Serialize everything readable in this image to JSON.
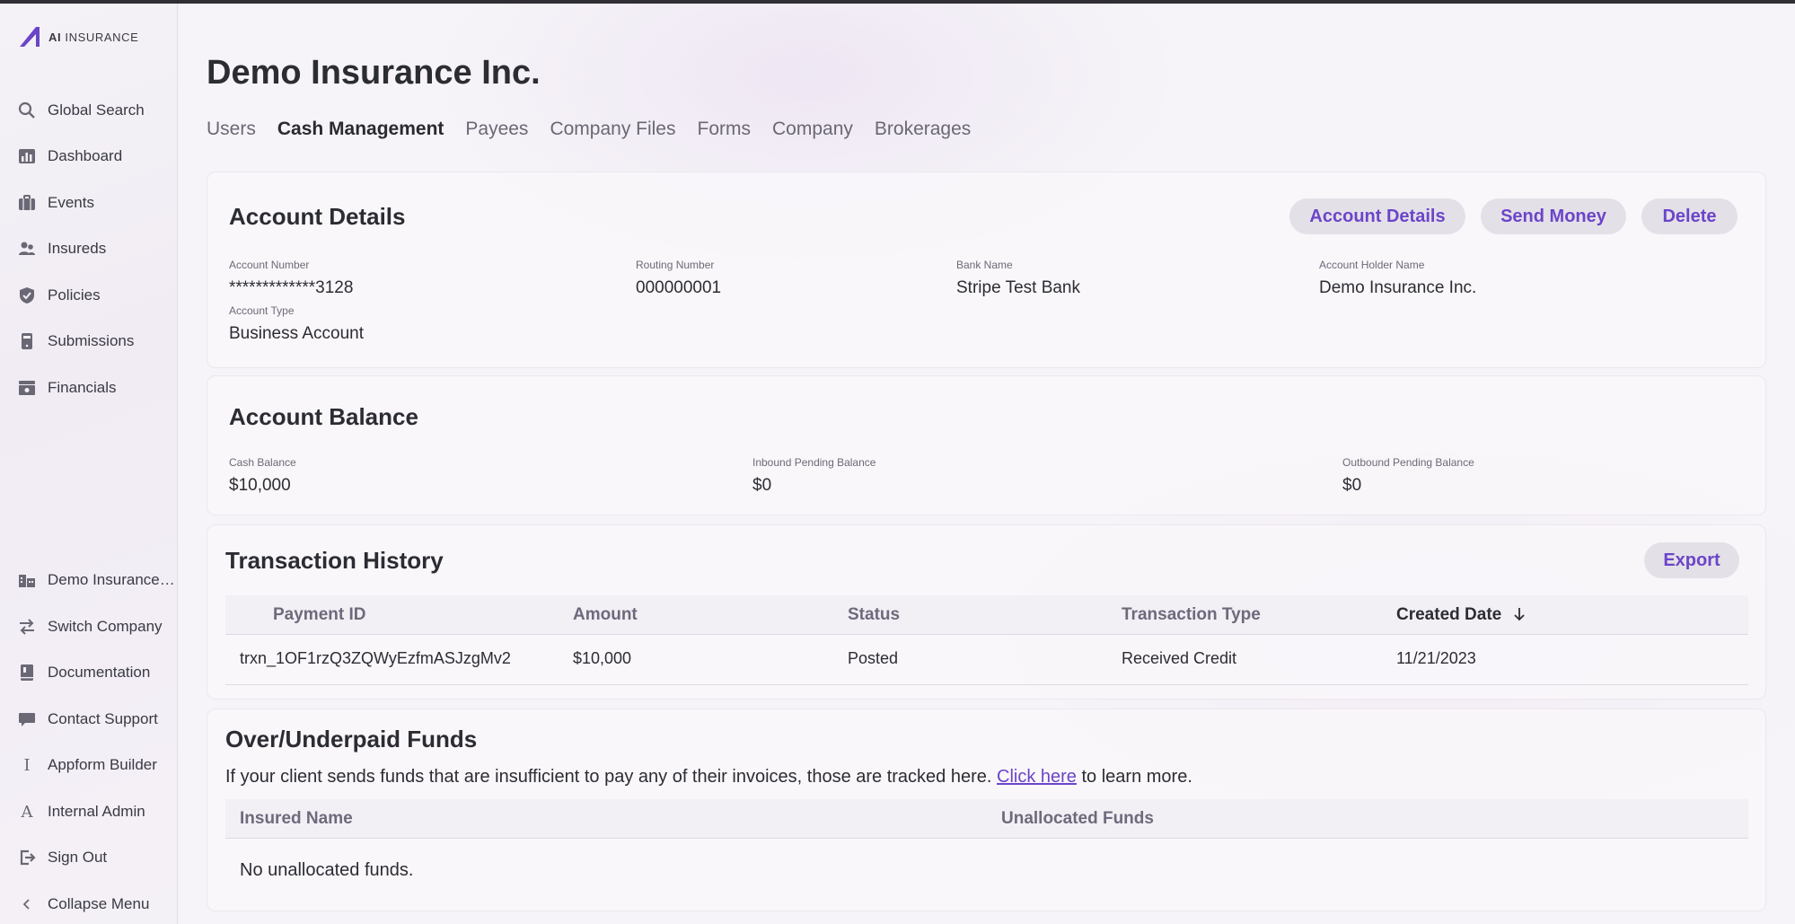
{
  "app": {
    "logo_text_bold": "AI",
    "logo_text": "INSURANCE",
    "accent_color": "#6b45c8"
  },
  "sidebar": {
    "items": [
      {
        "label": "Global Search",
        "icon": "search-icon"
      },
      {
        "label": "Dashboard",
        "icon": "bar-chart-icon"
      },
      {
        "label": "Events",
        "icon": "briefcase-icon"
      },
      {
        "label": "Insureds",
        "icon": "people-icon"
      },
      {
        "label": "Policies",
        "icon": "shield-icon"
      },
      {
        "label": "Submissions",
        "icon": "phone-icon"
      },
      {
        "label": "Financials",
        "icon": "cash-register-icon"
      }
    ],
    "bottom_items": [
      {
        "label": "Demo Insurance Inc.",
        "icon": "building-icon"
      },
      {
        "label": "Switch Company",
        "icon": "swap-arrows-icon"
      },
      {
        "label": "Documentation",
        "icon": "book-icon"
      },
      {
        "label": "Contact Support",
        "icon": "chat-bubble-icon"
      },
      {
        "label": "Appform Builder",
        "icon": "text-cursor-icon",
        "glyph": "I"
      },
      {
        "label": "Internal Admin",
        "icon": "letter-a-icon",
        "glyph": "A"
      },
      {
        "label": "Sign Out",
        "icon": "sign-out-icon"
      },
      {
        "label": "Collapse Menu",
        "icon": "chevron-left-icon"
      }
    ]
  },
  "page": {
    "title": "Demo Insurance Inc.",
    "tabs": [
      "Users",
      "Cash Management",
      "Payees",
      "Company Files",
      "Forms",
      "Company",
      "Brokerages"
    ],
    "active_tab": "Cash Management"
  },
  "account_details": {
    "title": "Account Details",
    "buttons": {
      "details": "Account Details",
      "send": "Send Money",
      "delete": "Delete"
    },
    "fields": {
      "account_number_label": "Account Number",
      "account_number": "*************3128",
      "routing_number_label": "Routing Number",
      "routing_number": "000000001",
      "bank_name_label": "Bank Name",
      "bank_name": "Stripe Test Bank",
      "holder_label": "Account Holder Name",
      "holder": "Demo Insurance Inc.",
      "type_label": "Account Type",
      "type": "Business Account"
    }
  },
  "account_balance": {
    "title": "Account Balance",
    "cash_label": "Cash Balance",
    "cash": "$10,000",
    "inbound_label": "Inbound Pending Balance",
    "inbound": "$0",
    "outbound_label": "Outbound Pending Balance",
    "outbound": "$0"
  },
  "transactions": {
    "title": "Transaction History",
    "export_label": "Export",
    "columns": [
      "Payment ID",
      "Amount",
      "Status",
      "Transaction Type",
      "Created Date"
    ],
    "sort_icon": "arrow-down-icon",
    "rows": [
      {
        "payment_id": "trxn_1OF1rzQ3ZQWyEzfmASJzgMv2",
        "amount": "$10,000",
        "status": "Posted",
        "type": "Received Credit",
        "date": "11/21/2023"
      }
    ]
  },
  "overpaid": {
    "title": "Over/Underpaid Funds",
    "desc_before": "If your client sends funds that are insufficient to pay any of their invoices, those are tracked here.",
    "link_text": "Click here",
    "desc_after": "to learn more.",
    "columns": [
      "Insured Name",
      "Unallocated Funds"
    ],
    "empty_text": "No unallocated funds."
  }
}
